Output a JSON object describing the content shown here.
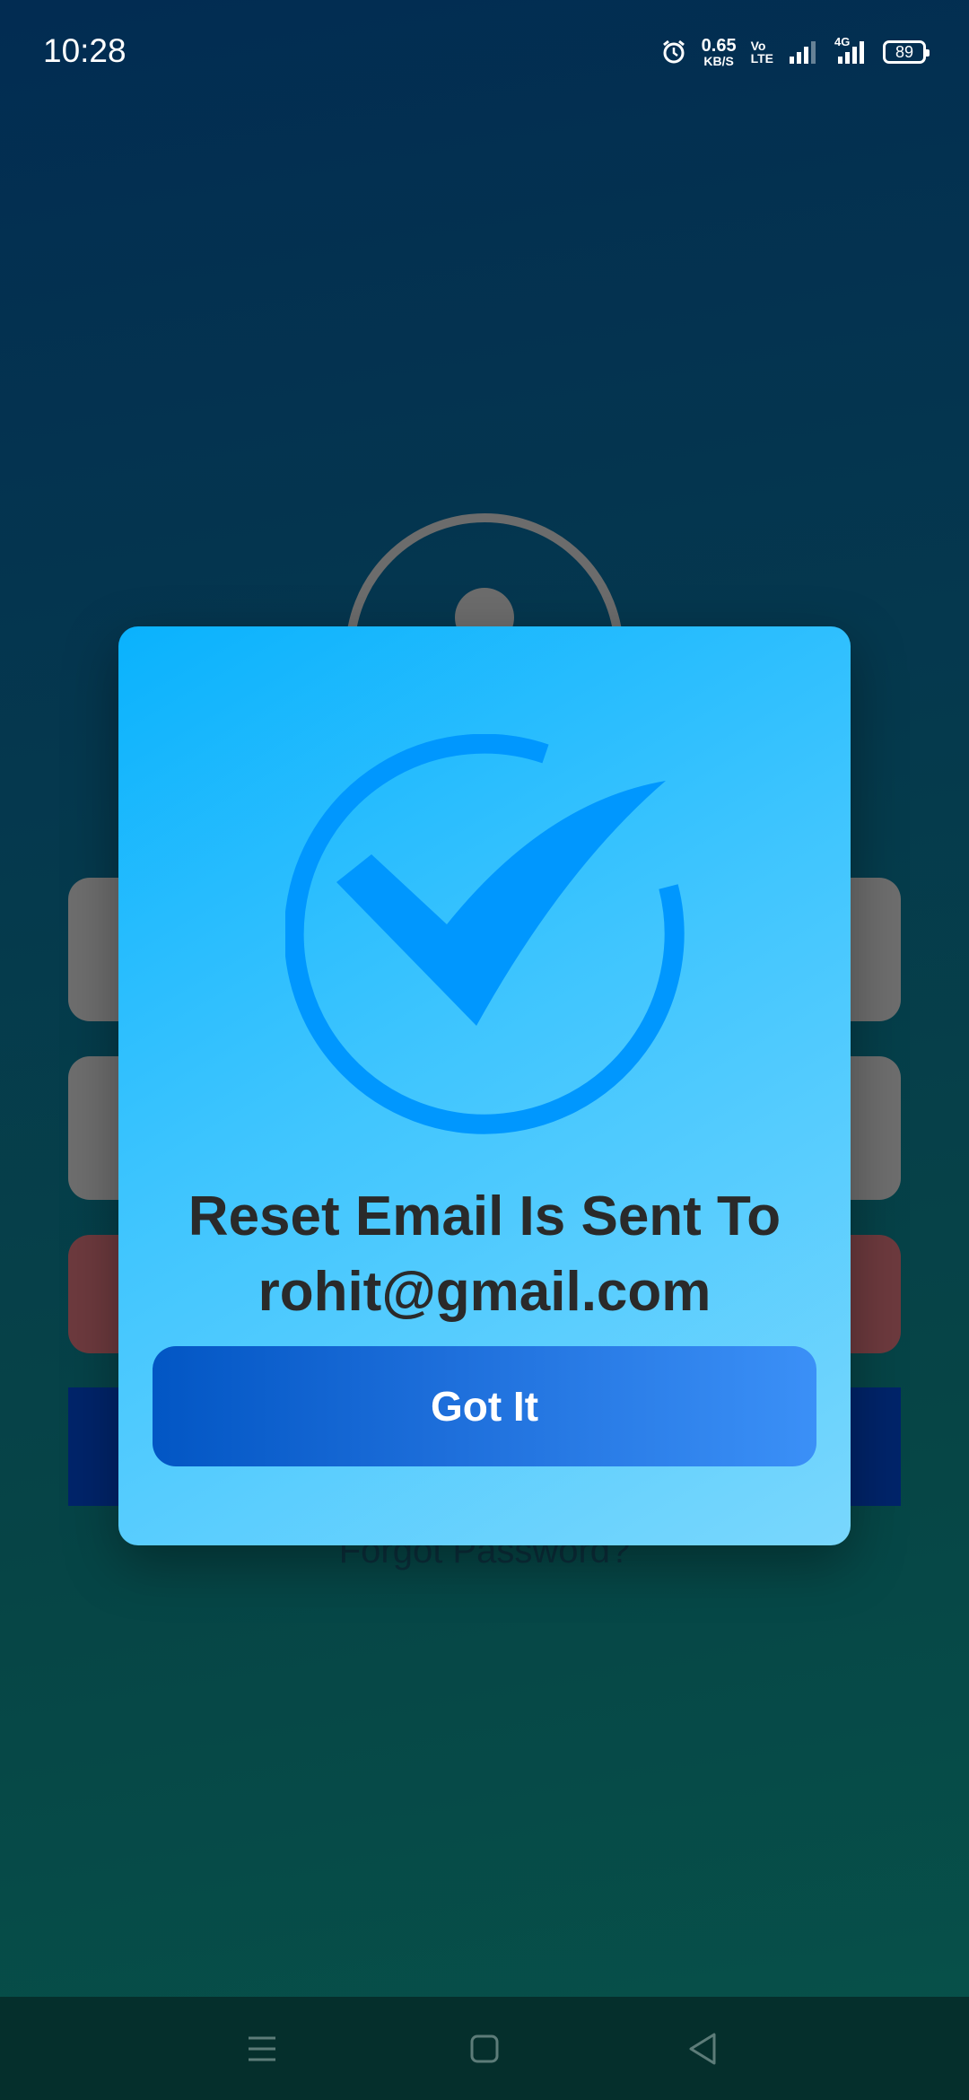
{
  "status_bar": {
    "time": "10:28",
    "net_speed": "0.65",
    "net_unit": "KB/S",
    "volte_top": "Vo",
    "volte_bottom": "LTE",
    "net_type": "4G",
    "battery": "89"
  },
  "background_screen": {
    "forgot_password": "Forgot Password?"
  },
  "dialog": {
    "icon": "check-circle-icon",
    "message_line1": "Reset Email Is Sent To",
    "message_line2": "rohit@gmail.com",
    "button_label": "Got It",
    "colors": {
      "card_start": "#0ab2fd",
      "card_end": "#79d7fd",
      "check": "#0097fe",
      "button_start": "#0256c4",
      "button_end": "#3b90f7",
      "text": "#2a2a2a"
    }
  },
  "nav_bar": {
    "icons": [
      "menu-icon",
      "home-square-icon",
      "back-triangle-icon"
    ]
  }
}
